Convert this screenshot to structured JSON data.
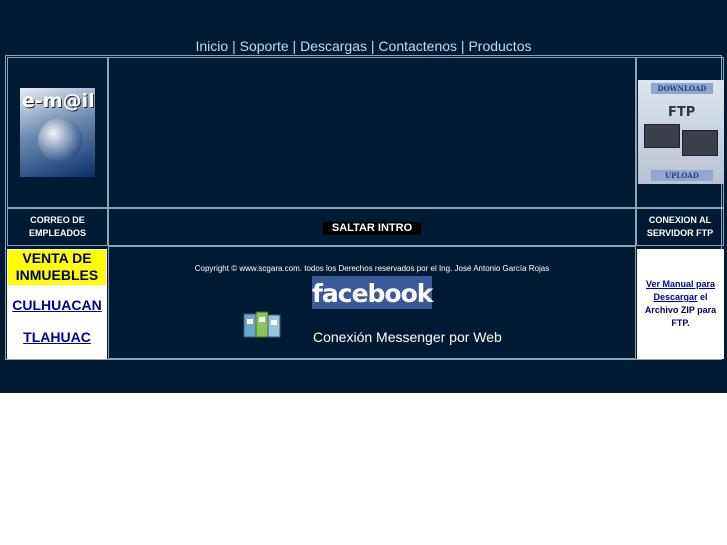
{
  "nav": {
    "items": [
      "Inicio",
      "Soporte",
      "Descargas",
      "Contactenos",
      "Productos"
    ],
    "separator": "|"
  },
  "email": {
    "icon_text": "e-m@il",
    "label": "CORREO DE EMPLEADOS"
  },
  "ftp": {
    "top_text": "DOWNLOAD",
    "mid_text": "FTP",
    "bottom_text": "UPLOAD",
    "label": "CONEXION AL SERVIDOR FTP"
  },
  "intro": {
    "skip_label": "SALTAR INTRO"
  },
  "footer": {
    "copyright": "Copyright © www.scgara.com. todos los Derechos reservados por el Ing. José Antonio García Rojas",
    "facebook_text": "facebook",
    "messenger_link": "Conexión Messenger por Web"
  },
  "venta": {
    "heading": "VENTA DE INMUEBLES",
    "links": [
      "CULHUACAN",
      "TLAHUAC"
    ]
  },
  "manual": {
    "link_text": "Ver Manual para Descargar",
    "rest_text": " el Archivo ZIP para FTP."
  },
  "colors": {
    "background": "#011a33",
    "border": "#8fa3b6",
    "facebook": "#3b5998",
    "highlight": "#ffff00"
  }
}
